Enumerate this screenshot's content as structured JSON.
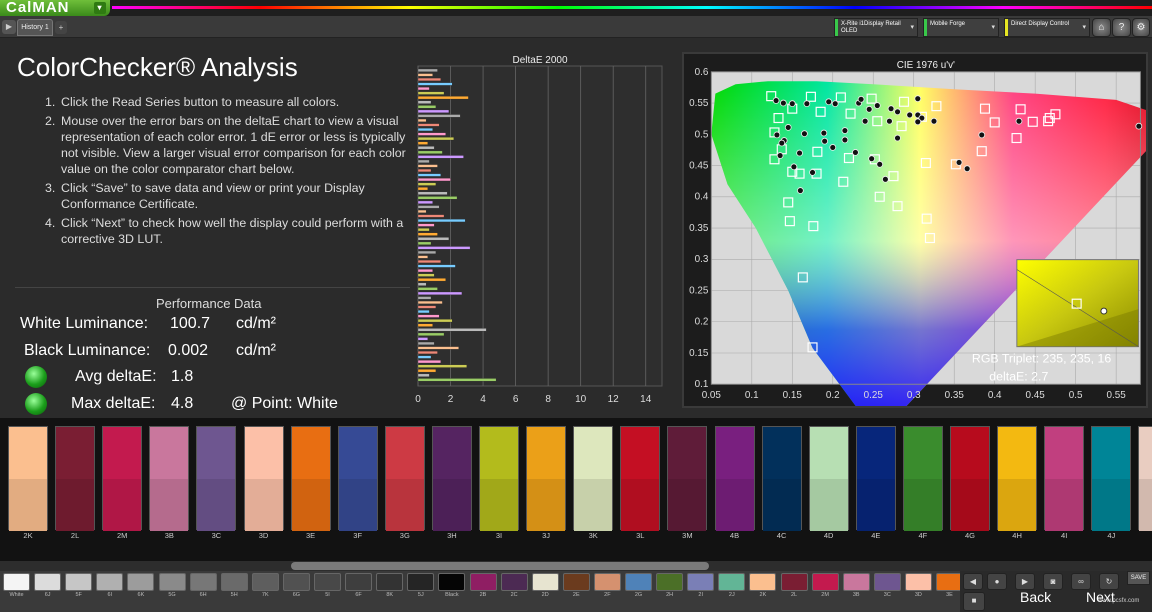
{
  "app": {
    "logo": "CalMAN",
    "logo_dd": "▾",
    "tab": "History 1",
    "tab_add": "+"
  },
  "toolbar": {
    "devices": [
      {
        "label": "X-Rite i1Display Retail\nOLED",
        "color": "#39c84a"
      },
      {
        "label": "Mobile Forge",
        "color": "#39c84a"
      },
      {
        "label": "Direct Display Control",
        "color": "#e6e623"
      }
    ],
    "icons": [
      "home-icon",
      "help-icon",
      "settings-icon"
    ]
  },
  "page": {
    "title": "ColorChecker® Analysis"
  },
  "steps": [
    {
      "n": "1.",
      "text": "Click the Read Series button to measure all colors."
    },
    {
      "n": "2.",
      "text": "Mouse over the error bars on the deltaE chart to view a visual representation of each color error. 1 dE error or less is typically not visible. View a larger visual error comparison for each color value on the color comparator chart below."
    },
    {
      "n": "3.",
      "text": "Click “Save” to save data and view or print your Display Conformance Certificate."
    },
    {
      "n": "4.",
      "text": "Click “Next” to check how well the display could perform with a corrective 3D LUT."
    }
  ],
  "performance": {
    "heading": "Performance Data",
    "white_label": "White Luminance:",
    "white_value": "100.7",
    "white_unit": "cd/m²",
    "black_label": "Black Luminance:",
    "black_value": "0.002",
    "black_unit": "cd/m²",
    "avg_label": "Avg deltaE:",
    "avg_value": "1.8",
    "max_label": "Max deltaE:",
    "max_value": "4.8",
    "max_point": "@ Point: White"
  },
  "chart_data": [
    {
      "type": "bar",
      "title": "DeltaE 2000",
      "orientation": "horizontal",
      "xlim": [
        0,
        15
      ],
      "xticks": [
        0,
        2,
        4,
        6,
        8,
        10,
        12,
        14
      ],
      "values": [
        1.2,
        0.9,
        1.4,
        2.1,
        0.7,
        1.6,
        3.1,
        0.8,
        1.1,
        1.9,
        2.6,
        0.5,
        1.3,
        0.9,
        1.7,
        2.2,
        0.6,
        1.0,
        1.5,
        2.8,
        0.7,
        1.2,
        0.8,
        1.4,
        2.0,
        1.1,
        0.6,
        1.8,
        2.4,
        0.9,
        1.3,
        0.5,
        1.6,
        2.9,
        1.0,
        0.7,
        1.2,
        1.9,
        0.8,
        3.2,
        1.1,
        0.6,
        1.4,
        2.3,
        0.9,
        1.0,
        1.7,
        0.5,
        1.2,
        2.7,
        0.8,
        1.5,
        1.1,
        0.7,
        1.3,
        2.1,
        0.9,
        4.2,
        1.6,
        0.6,
        1.0,
        2.5,
        1.2,
        0.8,
        1.4,
        3.0,
        1.1,
        0.7,
        4.8
      ]
    },
    {
      "type": "scatter",
      "title": "CIE 1976 u'v'",
      "xlim": [
        0.05,
        0.58
      ],
      "ylim": [
        0.1,
        0.6
      ],
      "xticks": [
        0.05,
        0.1,
        0.15,
        0.2,
        0.25,
        0.3,
        0.35,
        0.4,
        0.45,
        0.5,
        0.55
      ],
      "yticks": [
        0.1,
        0.15,
        0.2,
        0.25,
        0.3,
        0.35,
        0.4,
        0.45,
        0.5,
        0.55,
        0.6
      ],
      "targets": [
        [
          0.124,
          0.561
        ],
        [
          0.173,
          0.56
        ],
        [
          0.21,
          0.559
        ],
        [
          0.248,
          0.557
        ],
        [
          0.288,
          0.552
        ],
        [
          0.328,
          0.545
        ],
        [
          0.388,
          0.541
        ],
        [
          0.432,
          0.54
        ],
        [
          0.475,
          0.532
        ],
        [
          0.447,
          0.52
        ],
        [
          0.4,
          0.519
        ],
        [
          0.31,
          0.528
        ],
        [
          0.285,
          0.513
        ],
        [
          0.255,
          0.521
        ],
        [
          0.222,
          0.533
        ],
        [
          0.185,
          0.536
        ],
        [
          0.15,
          0.541
        ],
        [
          0.133,
          0.526
        ],
        [
          0.128,
          0.503
        ],
        [
          0.137,
          0.476
        ],
        [
          0.15,
          0.44
        ],
        [
          0.18,
          0.437
        ],
        [
          0.22,
          0.462
        ],
        [
          0.252,
          0.46
        ],
        [
          0.275,
          0.433
        ],
        [
          0.315,
          0.454
        ],
        [
          0.352,
          0.452
        ],
        [
          0.384,
          0.473
        ],
        [
          0.427,
          0.494
        ],
        [
          0.466,
          0.521
        ],
        [
          0.468,
          0.526
        ],
        [
          0.258,
          0.4
        ],
        [
          0.28,
          0.385
        ],
        [
          0.316,
          0.365
        ],
        [
          0.32,
          0.334
        ],
        [
          0.145,
          0.391
        ],
        [
          0.147,
          0.361
        ],
        [
          0.176,
          0.353
        ],
        [
          0.163,
          0.271
        ],
        [
          0.175,
          0.159
        ],
        [
          0.213,
          0.424
        ],
        [
          0.159,
          0.437
        ],
        [
          0.181,
          0.472
        ],
        [
          0.128,
          0.46
        ]
      ],
      "measured": [
        [
          0.13,
          0.554
        ],
        [
          0.139,
          0.55
        ],
        [
          0.15,
          0.549
        ],
        [
          0.168,
          0.549
        ],
        [
          0.195,
          0.552
        ],
        [
          0.203,
          0.549
        ],
        [
          0.232,
          0.55
        ],
        [
          0.255,
          0.546
        ],
        [
          0.272,
          0.541
        ],
        [
          0.28,
          0.536
        ],
        [
          0.305,
          0.531
        ],
        [
          0.295,
          0.531
        ],
        [
          0.31,
          0.526
        ],
        [
          0.325,
          0.521
        ],
        [
          0.27,
          0.521
        ],
        [
          0.24,
          0.521
        ],
        [
          0.215,
          0.506
        ],
        [
          0.189,
          0.502
        ],
        [
          0.165,
          0.501
        ],
        [
          0.145,
          0.511
        ],
        [
          0.14,
          0.49
        ],
        [
          0.137,
          0.486
        ],
        [
          0.135,
          0.466
        ],
        [
          0.152,
          0.448
        ],
        [
          0.175,
          0.439
        ],
        [
          0.2,
          0.479
        ],
        [
          0.215,
          0.491
        ],
        [
          0.228,
          0.471
        ],
        [
          0.248,
          0.461
        ],
        [
          0.258,
          0.452
        ],
        [
          0.265,
          0.428
        ],
        [
          0.356,
          0.455
        ],
        [
          0.366,
          0.445
        ],
        [
          0.384,
          0.499
        ],
        [
          0.43,
          0.521
        ],
        [
          0.578,
          0.513
        ],
        [
          0.131,
          0.499
        ],
        [
          0.159,
          0.47
        ],
        [
          0.28,
          0.494
        ],
        [
          0.305,
          0.52
        ],
        [
          0.16,
          0.41
        ],
        [
          0.19,
          0.489
        ],
        [
          0.305,
          0.557
        ],
        [
          0.235,
          0.556
        ],
        [
          0.245,
          0.54
        ]
      ],
      "inset": {
        "rgb_label": "RGB Triplet: 235, 235, 16",
        "delta_label": "deltaE: 2.7"
      }
    }
  ],
  "patches": [
    {
      "label": "2K",
      "color": "#fbbf8f"
    },
    {
      "label": "2L",
      "color": "#7a1e33"
    },
    {
      "label": "2M",
      "color": "#c31a4e"
    },
    {
      "label": "3B",
      "color": "#c9779d"
    },
    {
      "label": "3C",
      "color": "#6e5690"
    },
    {
      "label": "3D",
      "color": "#fcc0a8"
    },
    {
      "label": "3E",
      "color": "#e86e12"
    },
    {
      "label": "3F",
      "color": "#364a95"
    },
    {
      "label": "3G",
      "color": "#cd3a44"
    },
    {
      "label": "3H",
      "color": "#552461"
    },
    {
      "label": "3I",
      "color": "#b3bb1c"
    },
    {
      "label": "3J",
      "color": "#eba018"
    },
    {
      "label": "3K",
      "color": "#dde7bd"
    },
    {
      "label": "3L",
      "color": "#c40f23"
    },
    {
      "label": "3M",
      "color": "#5f1c39"
    },
    {
      "label": "4B",
      "color": "#791f7f"
    },
    {
      "label": "4C",
      "color": "#02305b"
    },
    {
      "label": "4D",
      "color": "#b7dfb3"
    },
    {
      "label": "4E",
      "color": "#07267b"
    },
    {
      "label": "4F",
      "color": "#3a8c2d"
    },
    {
      "label": "4G",
      "color": "#b70b1d"
    },
    {
      "label": "4H",
      "color": "#f3b911"
    },
    {
      "label": "4I",
      "color": "#c13f7f"
    },
    {
      "label": "4J",
      "color": "#008597"
    },
    {
      "label": "",
      "color": "#e9cdc1"
    }
  ],
  "thumbs": [
    {
      "label": "White",
      "color": "#f4f4f4"
    },
    {
      "label": "6J",
      "color": "#dcdcdc"
    },
    {
      "label": "5F",
      "color": "#c6c6c6"
    },
    {
      "label": "6I",
      "color": "#b0b0b0"
    },
    {
      "label": "6K",
      "color": "#9c9c9c"
    },
    {
      "label": "5G",
      "color": "#8a8a8a"
    },
    {
      "label": "6H",
      "color": "#777"
    },
    {
      "label": "5H",
      "color": "#6a6a6a"
    },
    {
      "label": "7K",
      "color": "#5e5e5e"
    },
    {
      "label": "6G",
      "color": "#515151"
    },
    {
      "label": "5I",
      "color": "#484848"
    },
    {
      "label": "6F",
      "color": "#3e3e3e"
    },
    {
      "label": "8K",
      "color": "#333"
    },
    {
      "label": "5J",
      "color": "#252525"
    },
    {
      "label": "Black",
      "color": "#050505"
    },
    {
      "label": "2B",
      "color": "#8f1e63"
    },
    {
      "label": "2C",
      "color": "#4c2a53"
    },
    {
      "label": "2D",
      "color": "#e7e4d0"
    },
    {
      "label": "2E",
      "color": "#6b3b1e"
    },
    {
      "label": "2F",
      "color": "#d5916f"
    },
    {
      "label": "2G",
      "color": "#4f82b8"
    },
    {
      "label": "2H",
      "color": "#4b6f27"
    },
    {
      "label": "2I",
      "color": "#7a7fb6"
    },
    {
      "label": "2J",
      "color": "#62b596"
    },
    {
      "label": "2K",
      "color": "#fbbf8f"
    },
    {
      "label": "2L",
      "color": "#7a1e33"
    },
    {
      "label": "2M",
      "color": "#c31a4e"
    },
    {
      "label": "3B",
      "color": "#c9779d"
    },
    {
      "label": "3C",
      "color": "#6e5690"
    },
    {
      "label": "3D",
      "color": "#fcc0a8"
    },
    {
      "label": "3E",
      "color": "#e86e12"
    }
  ],
  "controls": {
    "back": "Back",
    "next": "Next",
    "save": "SAVE",
    "watermark": "www.pcsfx.com"
  }
}
